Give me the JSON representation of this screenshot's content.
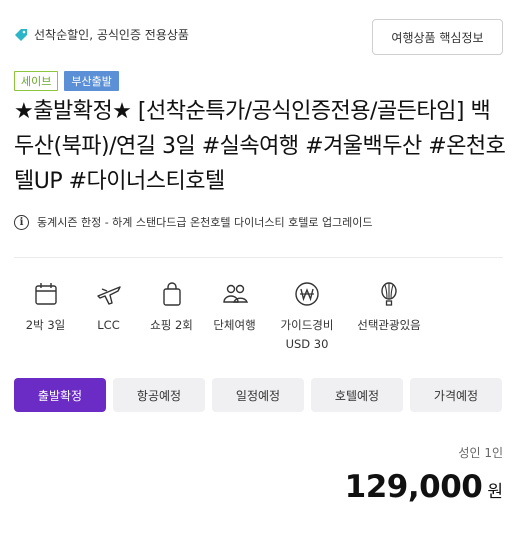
{
  "header": {
    "promo_text": "선착순할인, 공식인증 전용상품",
    "key_info_button": "여행상품 핵심정보"
  },
  "badges": {
    "save": "세이브",
    "departure": "부산출발"
  },
  "title": "★출발확정★ [선착순특가/공식인증전용/골든타임] 백두산(북파)/연길 3일 #실속여행 #겨울백두산 #온천호텔UP #다이너스티호텔",
  "notice": "동계시즌 한정 - 하계 스탠다드급 온천호텔 다이너스티 호텔로 업그레이드",
  "features": [
    {
      "icon": "calendar-icon",
      "label": "2박 3일"
    },
    {
      "icon": "airplane-icon",
      "label": "LCC"
    },
    {
      "icon": "shopping-bag-icon",
      "label": "쇼핑 2회"
    },
    {
      "icon": "group-icon",
      "label": "단체여행"
    },
    {
      "icon": "won-icon",
      "label": "가이드경비",
      "sub": "USD 30"
    },
    {
      "icon": "balloon-icon",
      "label": "선택관광있음"
    }
  ],
  "tabs": [
    "출발확정",
    "항공예정",
    "일정예정",
    "호텔예정",
    "가격예정"
  ],
  "price": {
    "per_person": "성인 1인",
    "amount": "129,000",
    "currency": "원"
  },
  "colors": {
    "accent": "#6a2cc4",
    "badge_save": "#8cc63f",
    "badge_departure": "#5b8fd6",
    "tag_icon": "#2bb5c8"
  }
}
